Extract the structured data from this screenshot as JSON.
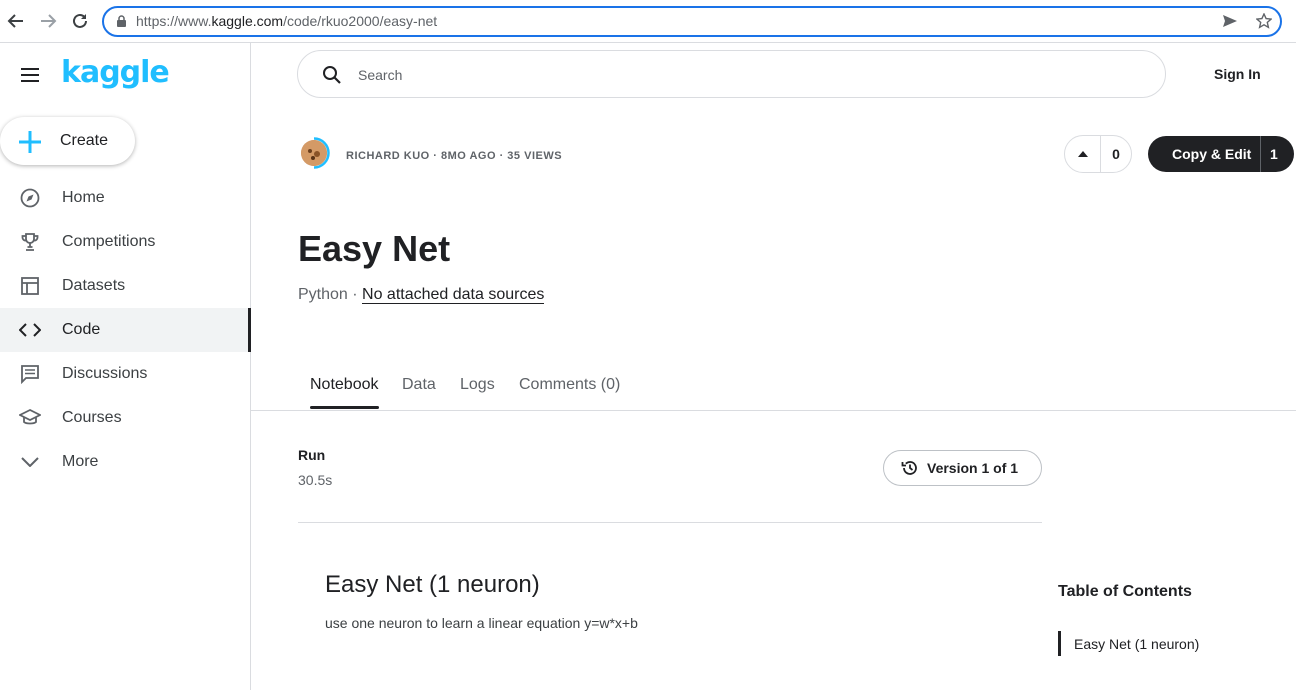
{
  "browser": {
    "url_prefix": "https://www.",
    "url_domain": "kaggle.com",
    "url_path": "/code/rkuo2000/easy-net"
  },
  "sidebar": {
    "logo": "kaggle",
    "create_label": "Create",
    "items": [
      {
        "label": "Home",
        "icon": "compass-icon"
      },
      {
        "label": "Competitions",
        "icon": "trophy-icon"
      },
      {
        "label": "Datasets",
        "icon": "table-icon"
      },
      {
        "label": "Code",
        "icon": "code-icon"
      },
      {
        "label": "Discussions",
        "icon": "comment-icon"
      },
      {
        "label": "Courses",
        "icon": "school-icon"
      },
      {
        "label": "More",
        "icon": "chevron-down-icon"
      }
    ],
    "active_item": "Code"
  },
  "header": {
    "search_placeholder": "Search",
    "sign_in": "Sign In"
  },
  "notebook": {
    "meta": "RICHARD KUO · 8MO AGO · 35 VIEWS",
    "votes": "0",
    "copy_edit_label": "Copy & Edit",
    "copy_edit_count": "1",
    "title": "Easy Net",
    "language": "Python",
    "separator": " · ",
    "data_sources": "No attached data sources",
    "tabs": [
      "Notebook",
      "Data",
      "Logs",
      "Comments (0)"
    ],
    "active_tab": "Notebook",
    "run_label": "Run",
    "run_time": "30.5s",
    "version_label": "Version 1 of 1",
    "content_heading": "Easy Net (1 neuron)",
    "content_text": "use one neuron to learn a linear equation y=w*x+b"
  },
  "toc": {
    "title": "Table of Contents",
    "items": [
      "Easy Net (1 neuron)"
    ]
  },
  "colors": {
    "brand": "#20beff",
    "dark": "#202124",
    "url_focus": "#1a73e8"
  }
}
